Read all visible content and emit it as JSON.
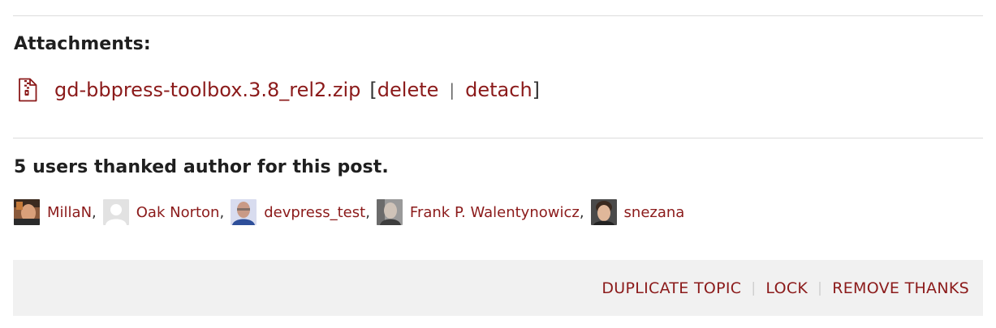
{
  "attachments": {
    "title": "Attachments:",
    "file": {
      "icon": "zip-file-icon",
      "name": "gd-bbpress-toolbox.3.8_rel2.zip",
      "open_bracket": "[",
      "delete_label": "delete",
      "separator": "|",
      "detach_label": "detach",
      "close_bracket": "]"
    }
  },
  "thanks": {
    "title": "5 users thanked author for this post.",
    "users": [
      {
        "name": "MillaN",
        "suffix": ",",
        "avatar": "avatar-photo"
      },
      {
        "name": "Oak Norton",
        "suffix": ",",
        "avatar": "avatar-placeholder"
      },
      {
        "name": "devpress_test",
        "suffix": ",",
        "avatar": "avatar-photo"
      },
      {
        "name": "Frank P. Walentynowicz",
        "suffix": ",",
        "avatar": "avatar-photo"
      },
      {
        "name": "snezana",
        "suffix": "",
        "avatar": "avatar-photo"
      }
    ]
  },
  "footer": {
    "actions": [
      {
        "label": "DUPLICATE TOPIC"
      },
      {
        "label": "LOCK"
      },
      {
        "label": "REMOVE THANKS"
      }
    ],
    "separator": "|"
  },
  "colors": {
    "link": "#8b1a1a",
    "footer_bg": "#f1f1f1",
    "divider": "#dcdcdc"
  }
}
